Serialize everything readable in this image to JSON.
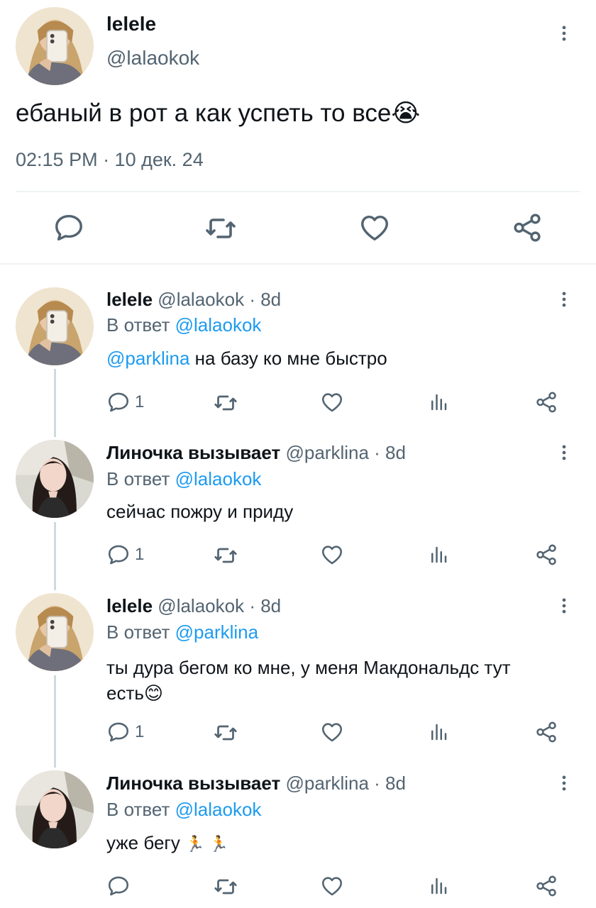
{
  "main_tweet": {
    "display_name": "lelele",
    "handle": "@lalaokok",
    "text": "ебаный в рот а как успеть то все",
    "emoji": "😭",
    "timestamp": "02:15 PM · 10 дек. 24"
  },
  "replies": [
    {
      "display_name": "lelele",
      "handle": "@lalaokok",
      "age": " · 8d",
      "reply_prefix": "В ответ ",
      "reply_to": "@lalaokok",
      "mention": "@parklina",
      "text": " на базу ко мне быстро",
      "reply_count": "1"
    },
    {
      "display_name": "Линочка вызывает",
      "handle": "@parklina",
      "age": " · 8d",
      "reply_prefix": "В ответ ",
      "reply_to": "@lalaokok",
      "text": "сейчас пожру и приду",
      "reply_count": "1"
    },
    {
      "display_name": "lelele",
      "handle": "@lalaokok",
      "age": " · 8d",
      "reply_prefix": "В ответ ",
      "reply_to": "@parklina",
      "text_line1": "ты дура бегом ко мне, у меня Макдональдс тут",
      "text_line2": "есть",
      "emoji": "😊",
      "reply_count": "1"
    },
    {
      "display_name": "Линочка вызывает",
      "handle": "@parklina",
      "age": " · 8d",
      "reply_prefix": "В ответ ",
      "reply_to": "@lalaokok",
      "text": "уже бегу ",
      "emoji": "🏃 🏃",
      "reply_count": ""
    }
  ],
  "icons": {
    "reply": "reply-icon",
    "retweet": "retweet-icon",
    "like": "like-icon",
    "views": "views-icon",
    "share": "share-icon",
    "more": "more-icon"
  },
  "colors": {
    "link": "#1d9bf0",
    "muted": "#536471",
    "text": "#0f1419"
  }
}
